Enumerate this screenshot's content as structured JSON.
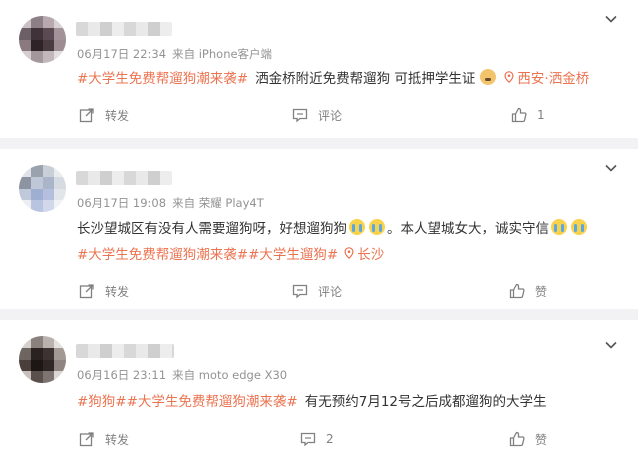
{
  "posts": [
    {
      "time": "06月17日 22:34",
      "source": "来自 iPhone客户端",
      "tag": "#大学生免费帮遛狗潮来袭#",
      "text": "洒金桥附近免费帮遛狗 可抵押学生证",
      "emoji": "dog-face-icon",
      "location": "西安·洒金桥",
      "actions": {
        "share": "转发",
        "comment": "评论",
        "like": "1"
      }
    },
    {
      "time": "06月17日 19:08",
      "source": "来自 荣耀 Play4T",
      "text_a": "长沙望城区有没有人需要遛狗呀，好想遛狗狗",
      "text_b": "。本人望城女大，诚实守信",
      "tags": "#大学生免费帮遛狗潮来袭##大学生遛狗#",
      "location": "长沙",
      "actions": {
        "share": "转发",
        "comment": "评论",
        "like": "赞"
      }
    },
    {
      "time": "06月16日 23:11",
      "source": "来自 moto edge X30",
      "tags": "#狗狗##大学生免费帮遛狗潮来袭#",
      "text": "有无预约7月12号之后成都遛狗的大学生",
      "actions": {
        "share": "转发",
        "comment": "2",
        "like": "赞"
      }
    }
  ],
  "colors": {
    "accent": "#eb7350",
    "meta": "#939393",
    "separator": "#f2f2f5"
  }
}
